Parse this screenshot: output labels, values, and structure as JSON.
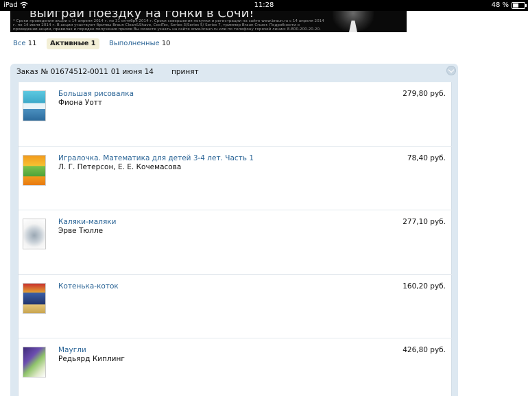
{
  "status_bar": {
    "carrier": "iPad",
    "time": "11:28",
    "battery_percent": "48 %",
    "battery_level": 0.48
  },
  "banner": {
    "headline": "выиграй поездку на гонки в Сочи!",
    "fine_print": "* Сроки проведения акции с 14 апреля 2014 г. по 31 октября 2014 г. Сроки совершения покупки и регистрации на сайте www.braun.ru с 14 апреля 2014 г. по 14 июля 2014 г. В акции участвуют бритвы Braun Clean&Shave, CoolTec, Series 3/Series 5/ Series 7, триммер Braun Cruzer. Подробности о проведении акции, правилах и порядке получения призов Вы можете узнать на сайте www.braun.ru или по телефону горячей линии: 8-800-200-20-20."
  },
  "tabs": [
    {
      "label": "Все",
      "count": "11"
    },
    {
      "label": "Активные",
      "count": "1"
    },
    {
      "label": "Выполненные",
      "count": "10"
    }
  ],
  "order": {
    "label": "Заказ",
    "number": "№ 01674512-0011",
    "date": "01 июня 14",
    "status": "принят"
  },
  "items": [
    {
      "title": "Большая рисовалка",
      "author": "Фиона Уотт",
      "price": "279,80 руб."
    },
    {
      "title": "Игралочка. Математика для детей 3-4 лет. Часть 1",
      "author": "Л. Г. Петерсон, Е. Е. Кочемасова",
      "price": "78,40 руб."
    },
    {
      "title": "Каляки-маляки",
      "author": "Эрве Тюлле",
      "price": "277,10 руб."
    },
    {
      "title": "Котенька-коток",
      "author": "",
      "price": "160,20 руб."
    },
    {
      "title": "Маугли",
      "author": "Редьярд Киплинг",
      "price": "426,80 руб."
    }
  ],
  "colors": {
    "link": "#2a6496",
    "panel": "#dde8f1",
    "active_tab": "#f3efd6"
  }
}
